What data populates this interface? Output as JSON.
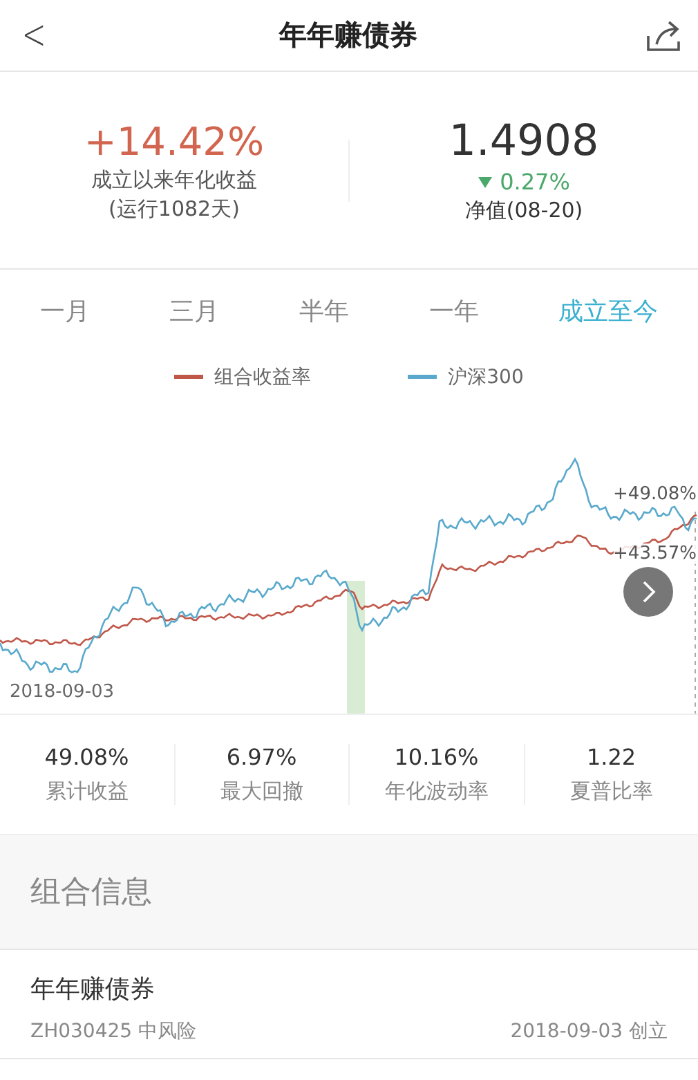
{
  "header": {
    "back": "<",
    "title": "年年赚债券"
  },
  "summary": {
    "annual_return": "+14.42%",
    "annual_label": "成立以来年化收益",
    "run_days": "(运行1082天)",
    "nav": "1.4908",
    "change": "0.27%",
    "nav_label": "净值(08-20)"
  },
  "periods": [
    {
      "label": "一月",
      "selected": false
    },
    {
      "label": "三月",
      "selected": false
    },
    {
      "label": "半年",
      "selected": false
    },
    {
      "label": "一年",
      "selected": false
    },
    {
      "label": "成立至今",
      "selected": true
    }
  ],
  "chart": {
    "legend": [
      {
        "name": "组合收益率",
        "color": "#c0584a"
      },
      {
        "name": "沪深300",
        "color": "#5aa9cc"
      }
    ],
    "start_date": "2018-09-03",
    "end_labels": [
      "+49.08%",
      "+43.57%"
    ]
  },
  "stats": [
    {
      "value": "49.08%",
      "label": "累计收益"
    },
    {
      "value": "6.97%",
      "label": "最大回撤"
    },
    {
      "value": "10.16%",
      "label": "年化波动率"
    },
    {
      "value": "1.22",
      "label": "夏普比率"
    }
  ],
  "section_title": "组合信息",
  "info": {
    "name": "年年赚债券",
    "code_risk": "ZH030425 中风险",
    "created": "2018-09-03 创立"
  }
}
